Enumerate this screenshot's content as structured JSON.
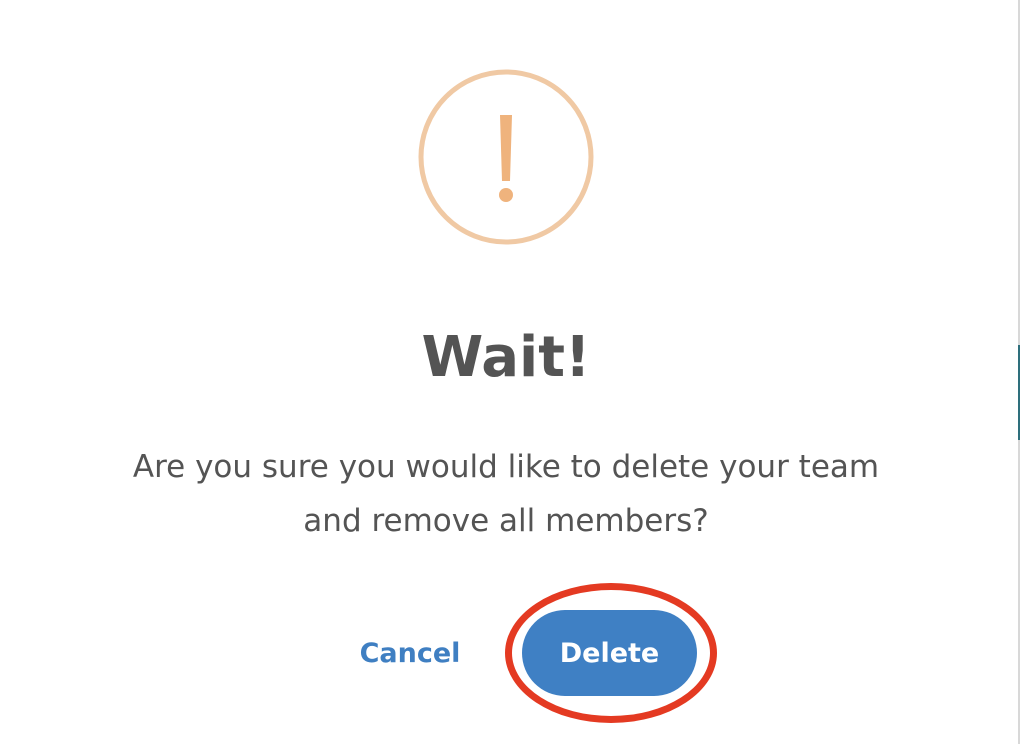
{
  "dialog": {
    "icon": "exclamation-icon",
    "title": "Wait!",
    "message_line1": "Are you sure you would like to delete your team",
    "message_line2": "and remove all members?",
    "cancel_label": "Cancel",
    "delete_label": "Delete"
  },
  "colors": {
    "icon": "#f0c9a4",
    "icon_mark": "#efb37d",
    "text": "#545454",
    "primary": "#3f80c4",
    "highlight": "#e43a22"
  }
}
